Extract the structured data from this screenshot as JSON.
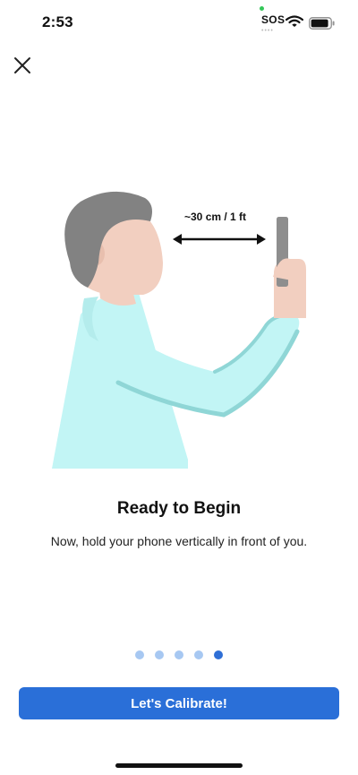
{
  "status_bar": {
    "time": "2:53",
    "carrier": "SOS",
    "carrier_dots": "••••",
    "wifi_icon": "wifi-icon",
    "battery_icon": "battery-icon",
    "privacy_dot_color": "#34c759"
  },
  "header": {
    "close_icon": "close-icon"
  },
  "illustration": {
    "distance_label": "~30 cm / 1 ft",
    "colors": {
      "hair": "#828282",
      "skin": "#f2cfc0",
      "shirt": "#c2f5f5",
      "shirt_outline": "#8fd6d6",
      "phone": "#8e8e8e"
    }
  },
  "content": {
    "title": "Ready to Begin",
    "subtitle": "Now, hold your phone vertically in front of you."
  },
  "pager": {
    "total": 5,
    "active_index": 4,
    "active_color": "#2f6fd6",
    "inactive_color": "#a7c8f2"
  },
  "footer": {
    "cta_label": "Let's Calibrate!",
    "cta_color": "#2a6fd8"
  }
}
